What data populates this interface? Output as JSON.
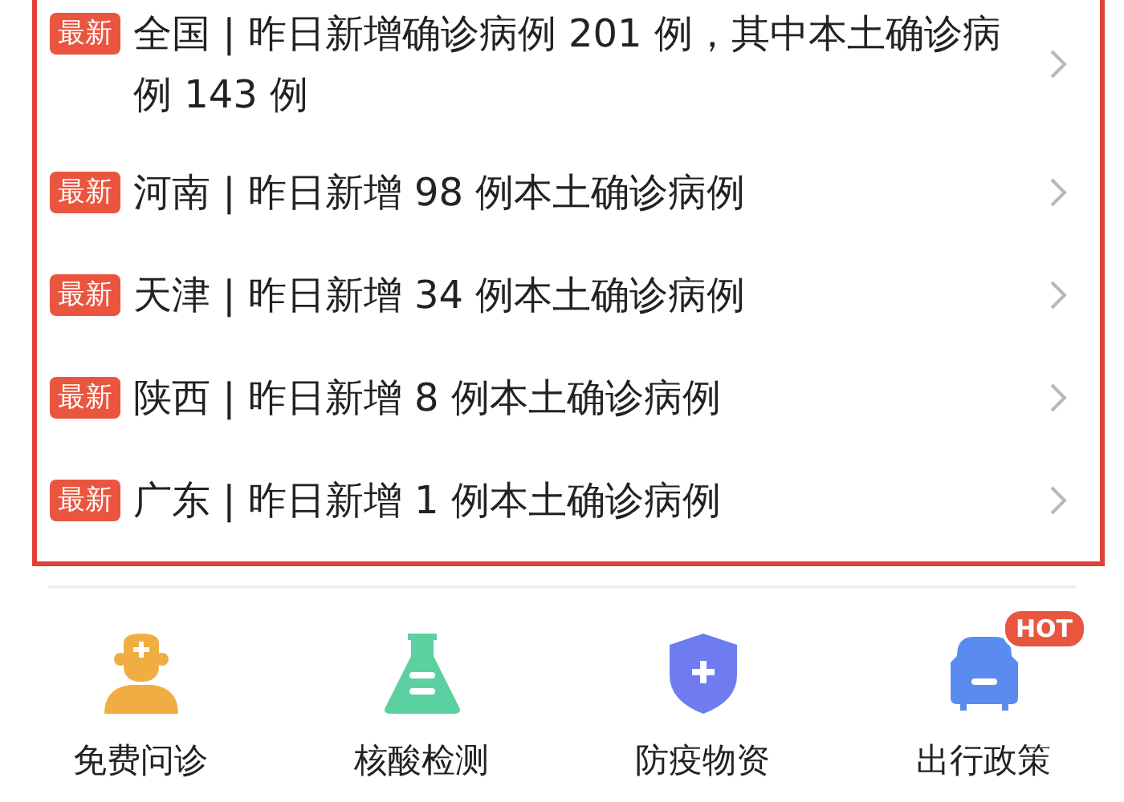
{
  "news": [
    {
      "badge": "最新",
      "text": "全国 | 昨日新增确诊病例 201 例，其中本土确诊病例 143 例"
    },
    {
      "badge": "最新",
      "text": "河南 | 昨日新增 98 例本土确诊病例"
    },
    {
      "badge": "最新",
      "text": "天津 | 昨日新增 34 例本土确诊病例"
    },
    {
      "badge": "最新",
      "text": "陕西 | 昨日新增 8 例本土确诊病例"
    },
    {
      "badge": "最新",
      "text": "广东 | 昨日新增 1 例本土确诊病例"
    }
  ],
  "services": [
    {
      "kind": "doctor",
      "label": "免费问诊"
    },
    {
      "kind": "flask",
      "label": "核酸检测"
    },
    {
      "kind": "shield",
      "label": "防疫物资"
    },
    {
      "kind": "car",
      "label": "出行政策",
      "badge": "HOT"
    }
  ]
}
